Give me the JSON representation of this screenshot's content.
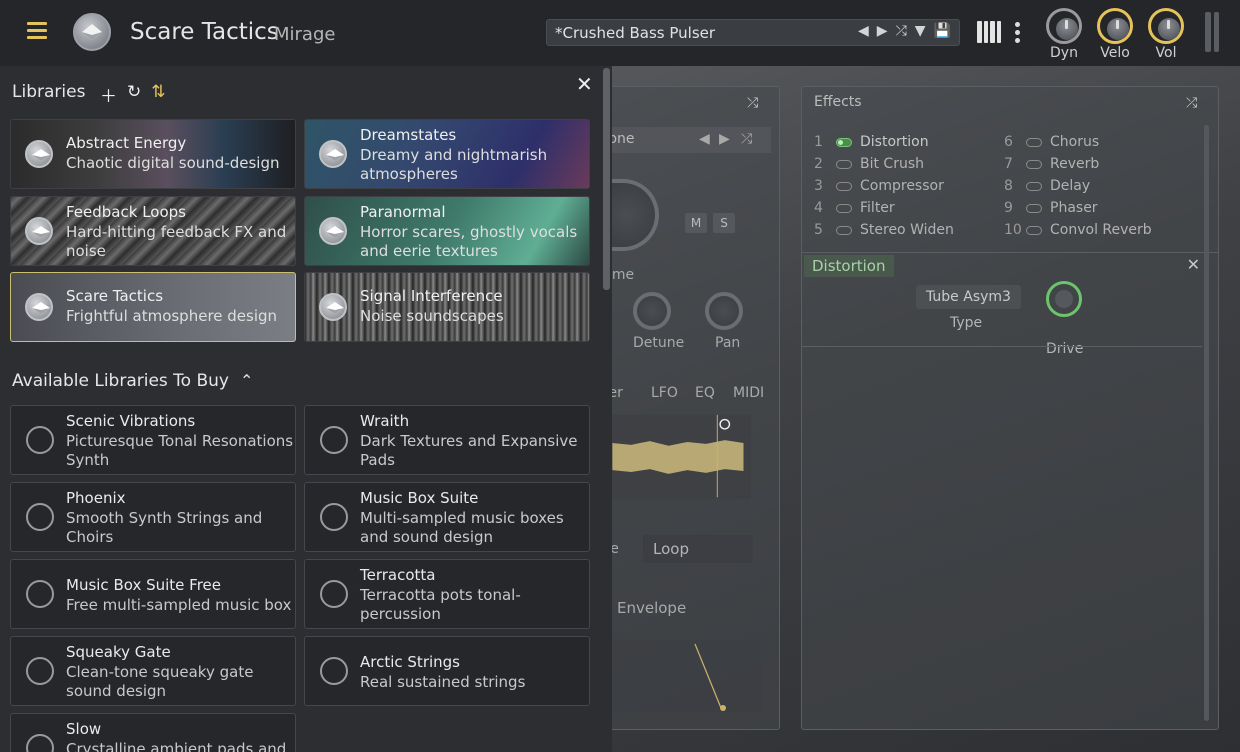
{
  "header": {
    "title": "Scare Tactics",
    "subtitle": "Mirage",
    "preset": "*Crushed Bass Pulser",
    "knobs": [
      "Dyn",
      "Velo",
      "Vol"
    ]
  },
  "colors": {
    "accent": "#e6c35a",
    "green": "#6cc46c"
  },
  "libraries": {
    "heading": "Libraries",
    "installed": [
      {
        "title": "Abstract Energy",
        "sub": "Chaotic digital sound-design"
      },
      {
        "title": "Dreamstates",
        "sub": "Dreamy and nightmarish atmospheres"
      },
      {
        "title": "Feedback Loops",
        "sub": "Hard-hitting feedback FX and noise"
      },
      {
        "title": "Paranormal",
        "sub": "Horror scares, ghostly vocals and eerie textures"
      },
      {
        "title": "Scare Tactics",
        "sub": "Frightful atmosphere design"
      },
      {
        "title": "Signal Interference",
        "sub": "Noise soundscapes"
      }
    ],
    "buy_heading": "Available Libraries To Buy",
    "buy": [
      {
        "title": "Scenic Vibrations",
        "sub": "Picturesque Tonal Resonations Synth"
      },
      {
        "title": "Wraith",
        "sub": "Dark Textures and Expansive Pads"
      },
      {
        "title": "Phoenix",
        "sub": "Smooth Synth Strings and Choirs"
      },
      {
        "title": "Music Box Suite",
        "sub": "Multi-sampled music boxes and sound design"
      },
      {
        "title": "Music Box Suite Free",
        "sub": "Free multi-sampled music box"
      },
      {
        "title": "Terracotta",
        "sub": "Terracotta pots tonal-percussion"
      },
      {
        "title": "Squeaky Gate",
        "sub": "Clean-tone squeaky gate sound design"
      },
      {
        "title": "Arctic Strings",
        "sub": "Real sustained strings"
      },
      {
        "title": "Slow",
        "sub": "Crystalline ambient pads and"
      }
    ]
  },
  "effects": {
    "title": "Effects",
    "items": [
      {
        "num": "1",
        "name": "Distortion"
      },
      {
        "num": "2",
        "name": "Bit Crush"
      },
      {
        "num": "3",
        "name": "Compressor"
      },
      {
        "num": "4",
        "name": "Filter"
      },
      {
        "num": "5",
        "name": "Stereo Widen"
      },
      {
        "num": "6",
        "name": "Chorus"
      },
      {
        "num": "7",
        "name": "Reverb"
      },
      {
        "num": "8",
        "name": "Delay"
      },
      {
        "num": "9",
        "name": "Phaser"
      },
      {
        "num": "10",
        "name": "Convol Reverb"
      }
    ],
    "active": "Distortion",
    "type_value": "Tube Asym3",
    "type_label": "Type",
    "drive_label": "Drive"
  },
  "layer": {
    "source": "rone",
    "m": "M",
    "s": "S",
    "volume": "ume",
    "detune": "Detune",
    "pan": "Pan",
    "tabs": [
      "ter",
      "LFO",
      "EQ",
      "MIDI"
    ],
    "loop_left": "se",
    "loop": "Loop",
    "envelope": "e Envelope"
  }
}
